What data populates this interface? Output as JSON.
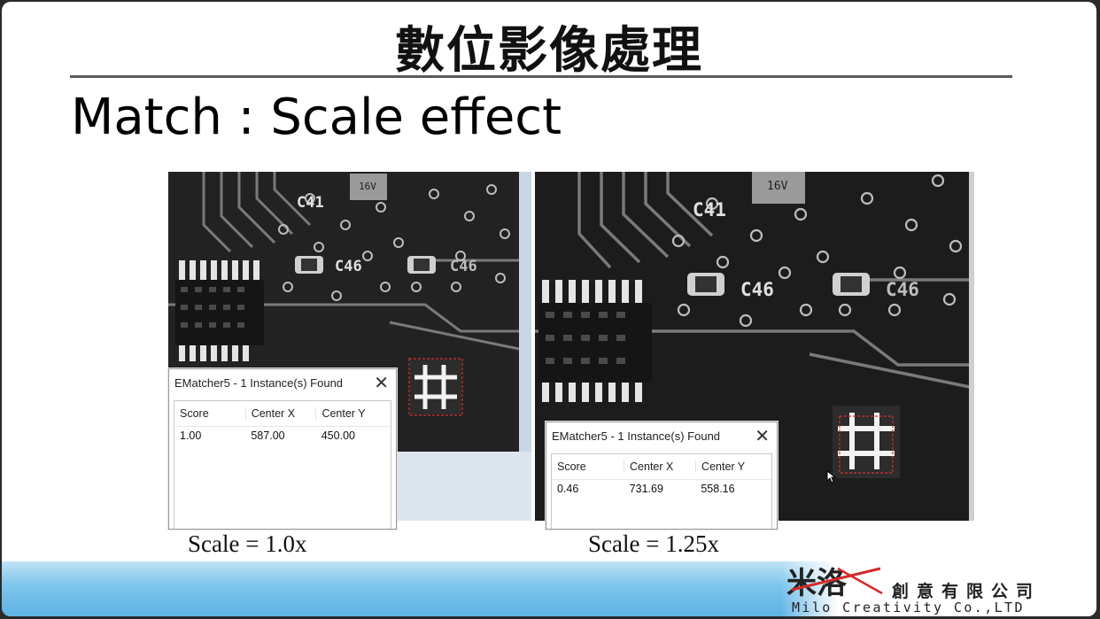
{
  "slide": {
    "title": "數位影像處理",
    "subtitle": "Match : Scale effect"
  },
  "left_panel": {
    "dialog": {
      "title": "EMatcher5 - 1 Instance(s) Found",
      "close_glyph": "✕",
      "columns": [
        "Score",
        "Center X",
        "Center Y"
      ],
      "rows": [
        [
          "1.00",
          "587.00",
          "450.00"
        ]
      ]
    },
    "pcb_labels": [
      "16V",
      "C41",
      "C46",
      "C46"
    ],
    "caption": "Scale = 1.0x"
  },
  "right_panel": {
    "dialog": {
      "title": "EMatcher5 - 1 Instance(s) Found",
      "close_glyph": "✕",
      "columns": [
        "Score",
        "Center X",
        "Center Y"
      ],
      "rows": [
        [
          "0.46",
          "731.69",
          "558.16"
        ]
      ]
    },
    "pcb_labels": [
      "16V",
      "C41",
      "C46",
      "C46"
    ],
    "caption": "Scale = 1.25x"
  },
  "footer": {
    "company_cn": "創意有限公司",
    "company_en": "Milo Creativity Co.,LTD",
    "logo_text": "米洛"
  },
  "colors": {
    "footer_blue": "#6cbbe9",
    "match_box": "#d83030",
    "title_rule": "#5a5a5a"
  },
  "icons": [
    "close-icon",
    "mouse-cursor-icon",
    "company-logo-icon"
  ]
}
